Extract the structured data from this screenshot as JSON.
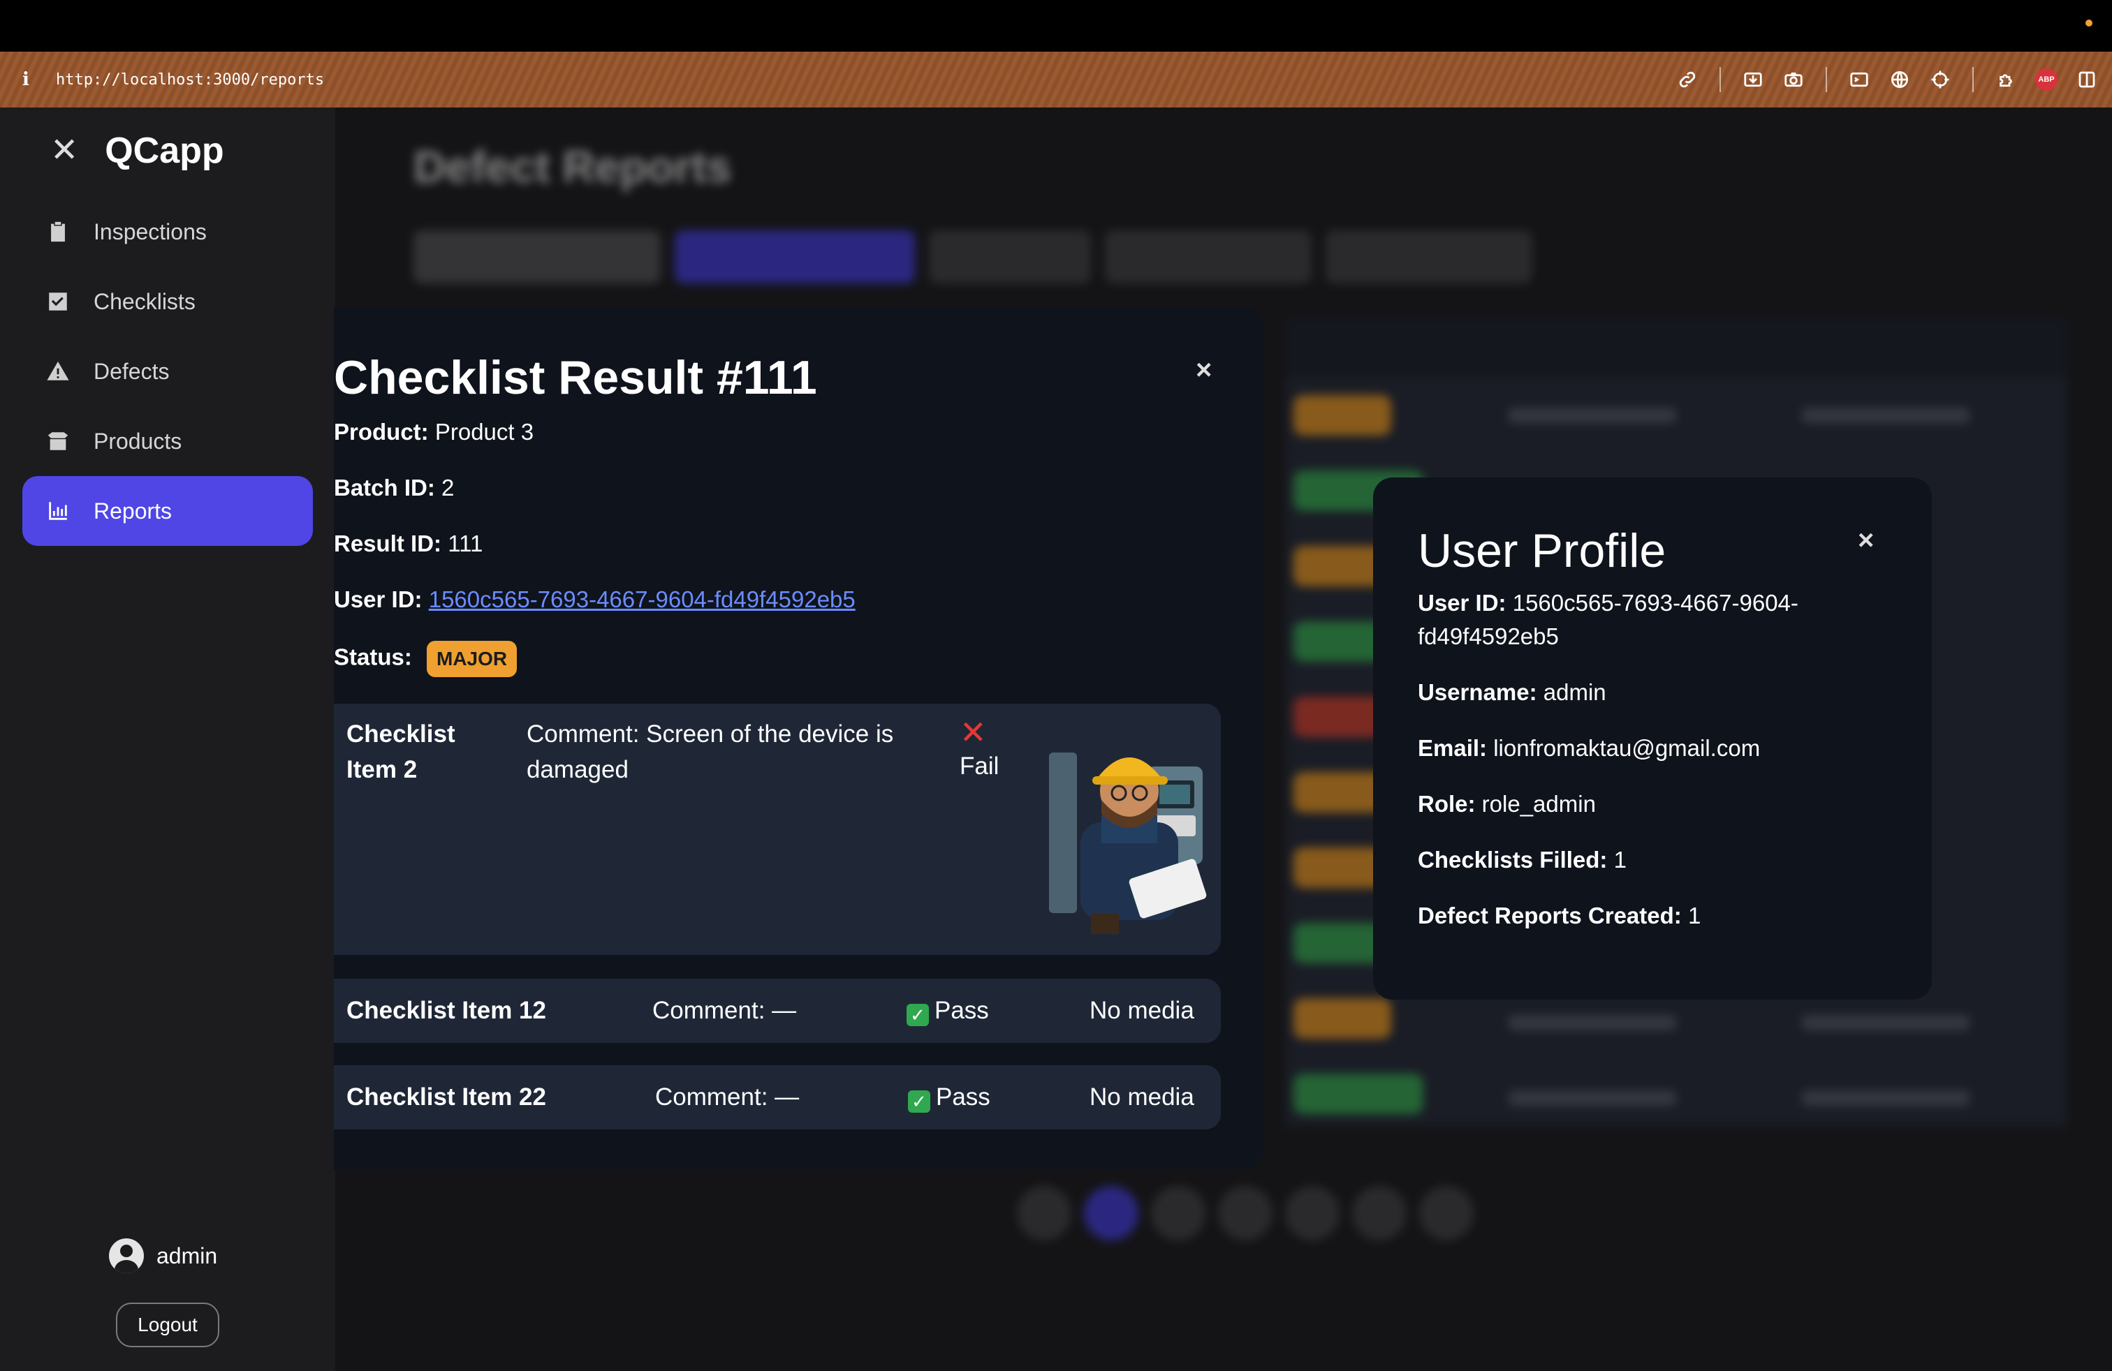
{
  "browser": {
    "info_icon": "info-icon",
    "url": "http://localhost:3000/reports",
    "tools": [
      "link-icon",
      "save-icon",
      "camera-icon",
      "terminal-icon",
      "globe-icon",
      "crosshair-icon",
      "extension-icon",
      "adblock-icon",
      "sidebar-icon"
    ],
    "adblock_label": "ABP"
  },
  "sidebar": {
    "close_glyph": "✕",
    "brand": "QCapp",
    "items": [
      {
        "label": "Inspections",
        "icon": "clipboard-icon",
        "active": false
      },
      {
        "label": "Checklists",
        "icon": "checkbox-icon",
        "active": false
      },
      {
        "label": "Defects",
        "icon": "warning-icon",
        "active": false
      },
      {
        "label": "Products",
        "icon": "box-icon",
        "active": false
      },
      {
        "label": "Reports",
        "icon": "bar-chart-icon",
        "active": true
      }
    ],
    "username": "admin",
    "logout_label": "Logout"
  },
  "background": {
    "page_title": "Defect Reports"
  },
  "checklist_modal": {
    "title": "Checklist Result #111",
    "close_glyph": "×",
    "product_label": "Product:",
    "product_value": "Product 3",
    "batch_label": "Batch ID:",
    "batch_value": "2",
    "result_label": "Result ID:",
    "result_value": "111",
    "user_label": "User ID:",
    "user_value": "1560c565-7693-4667-9604-fd49f4592eb5",
    "status_label": "Status:",
    "status_value": "MAJOR",
    "items": [
      {
        "name": "Checklist Item 2",
        "comment": "Comment: Screen of the device is damaged",
        "result": "Fail",
        "media": "engineer-image"
      },
      {
        "name": "Checklist Item 12",
        "comment": "Comment: —",
        "result": "Pass",
        "media": "No media"
      },
      {
        "name": "Checklist Item 22",
        "comment": "Comment: —",
        "result": "Pass",
        "media": "No media"
      }
    ]
  },
  "profile_modal": {
    "title": "User Profile",
    "close_glyph": "×",
    "user_id_label": "User ID:",
    "user_id_value": "1560c565-7693-4667-9604-fd49f4592eb5",
    "username_label": "Username:",
    "username_value": "admin",
    "email_label": "Email:",
    "email_value": "lionfromaktau@gmail.com",
    "role_label": "Role:",
    "role_value": "role_admin",
    "checklists_label": "Checklists Filled:",
    "checklists_value": "1",
    "defects_label": "Defect Reports Created:",
    "defects_value": "1"
  },
  "colors": {
    "accent": "#4f46e5",
    "major": "#f0a030",
    "fail": "#e53935",
    "pass": "#2fa84f",
    "link": "#6c8cff"
  }
}
